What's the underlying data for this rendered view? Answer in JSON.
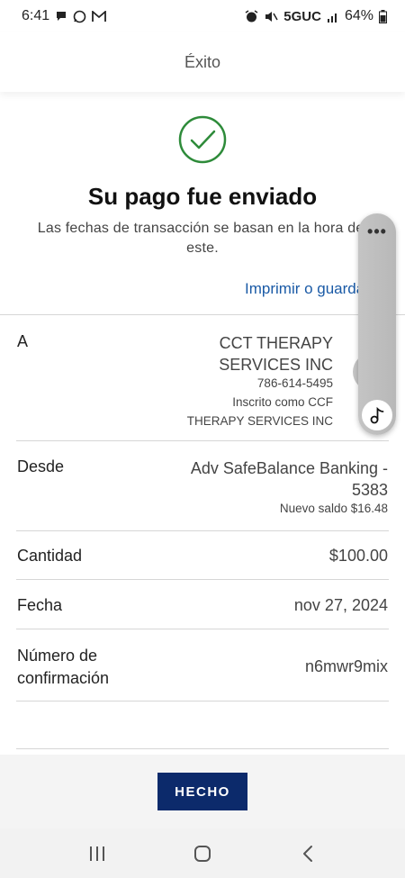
{
  "status_bar": {
    "time": "6:41",
    "network": "5GUC",
    "battery": "64%"
  },
  "header": {
    "title": "Éxito"
  },
  "success": {
    "title": "Su pago fue enviado",
    "subtitle": "Las fechas de transacción se basan en la hora del este.",
    "print_link": "Imprimir o guardar"
  },
  "details": {
    "to": {
      "label": "A",
      "name_line1": "CCT THERAPY",
      "name_line2": "SERVICES INC",
      "phone": "786-614-5495",
      "enrolled_line1": "Inscrito como CCF",
      "enrolled_line2": "THERAPY SERVICES INC"
    },
    "from": {
      "label": "Desde",
      "account_line1": "Adv SafeBalance Banking -",
      "account_line2": "5383",
      "new_balance": "Nuevo saldo $16.48"
    },
    "amount": {
      "label": "Cantidad",
      "value": "$100.00"
    },
    "date": {
      "label": "Fecha",
      "value": "nov 27, 2024"
    },
    "confirmation": {
      "label_line1": "Número de",
      "label_line2": "confirmación",
      "value": "n6mwr9mix"
    }
  },
  "actions": {
    "done_label": "HECHO"
  },
  "side_panel": {
    "dots": "•••"
  },
  "icons": {
    "success": "check-circle-icon",
    "music": "music-note-icon"
  },
  "colors": {
    "success_green": "#2e8b3a",
    "link_blue": "#1a5aa6",
    "button_navy": "#0c2a6b"
  }
}
